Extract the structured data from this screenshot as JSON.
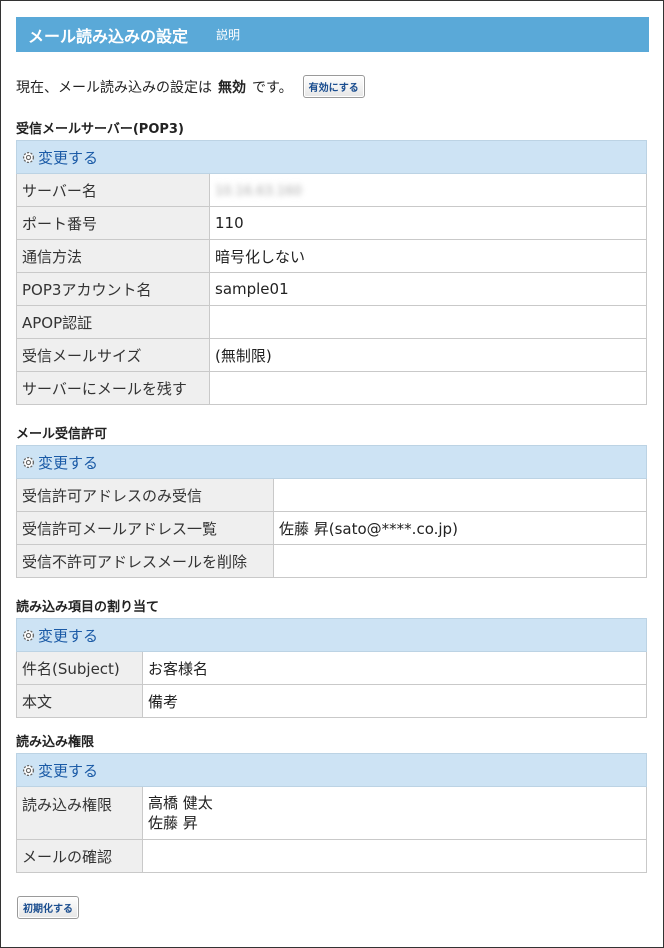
{
  "header": {
    "title": "メール読み込みの設定",
    "help_link": "説明"
  },
  "status": {
    "prefix": "現在、メール読み込みの設定は",
    "value": "無効",
    "suffix": "です。",
    "enable_button": "有効にする"
  },
  "change_label": "変更する",
  "pop3": {
    "title": "受信メールサーバー(POP3)",
    "rows": [
      {
        "label": "サーバー名",
        "value": "10.16.63.160"
      },
      {
        "label": "ポート番号",
        "value": "110"
      },
      {
        "label": "通信方法",
        "value": "暗号化しない"
      },
      {
        "label": "POP3アカウント名",
        "value": "sample01"
      },
      {
        "label": "APOP認証",
        "value": ""
      },
      {
        "label": "受信メールサイズ",
        "value": "(無制限)"
      },
      {
        "label": "サーバーにメールを残す",
        "value": ""
      }
    ]
  },
  "permit": {
    "title": "メール受信許可",
    "rows": [
      {
        "label": "受信許可アドレスのみ受信",
        "value": ""
      },
      {
        "label": "受信許可メールアドレス一覧",
        "value": "佐藤 昇(sato@****.co.jp)"
      },
      {
        "label": "受信不許可アドレスメールを削除",
        "value": ""
      }
    ]
  },
  "mapping": {
    "title": "読み込み項目の割り当て",
    "rows": [
      {
        "label": "件名(Subject)",
        "value": "お客様名"
      },
      {
        "label": "本文",
        "value": "備考"
      }
    ]
  },
  "auth": {
    "title": "読み込み権限",
    "rows": [
      {
        "label": "読み込み権限",
        "value_lines": [
          "高橋 健太",
          "佐藤 昇"
        ]
      },
      {
        "label": "メールの確認",
        "value": ""
      }
    ]
  },
  "reset_button": "初期化する"
}
